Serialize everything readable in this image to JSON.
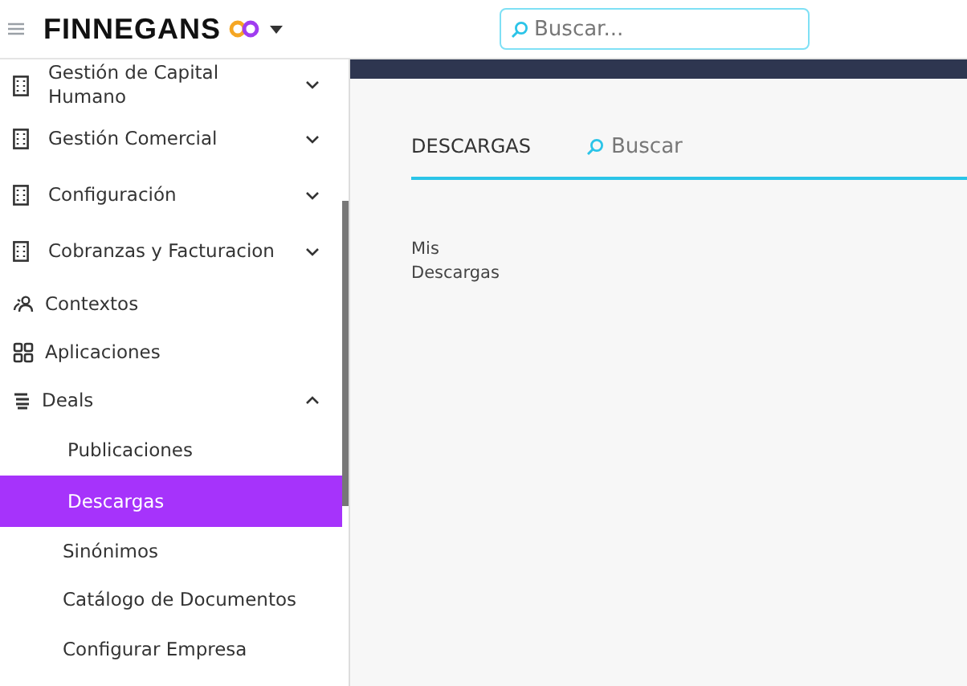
{
  "header": {
    "logo": "FINNEGANS",
    "search": {
      "placeholder": "Buscar..."
    }
  },
  "sidebar": {
    "items": [
      {
        "kind": "module",
        "label": "Gestión de Capital Humano",
        "expanded": false
      },
      {
        "kind": "module",
        "label": "Gestión Comercial",
        "expanded": false
      },
      {
        "kind": "module",
        "label": "Configuración",
        "expanded": false
      },
      {
        "kind": "module",
        "label": "Cobranzas y Facturacion",
        "expanded": false
      },
      {
        "kind": "contexts",
        "label": "Contextos"
      },
      {
        "kind": "apps",
        "label": "Aplicaciones"
      },
      {
        "kind": "deals",
        "label": "Deals",
        "expanded": true,
        "children": [
          {
            "label": "Publicaciones",
            "selected": false
          },
          {
            "label": "Descargas",
            "selected": true
          }
        ]
      },
      {
        "kind": "plain",
        "label": "Sinónimos"
      },
      {
        "kind": "plain",
        "label": "Catálogo de Documentos"
      },
      {
        "kind": "plain",
        "label": "Configurar Empresa"
      }
    ]
  },
  "main": {
    "tab": "DESCARGAS",
    "search": {
      "placeholder": "Buscar"
    },
    "items": [
      "Mis Descargas"
    ]
  }
}
